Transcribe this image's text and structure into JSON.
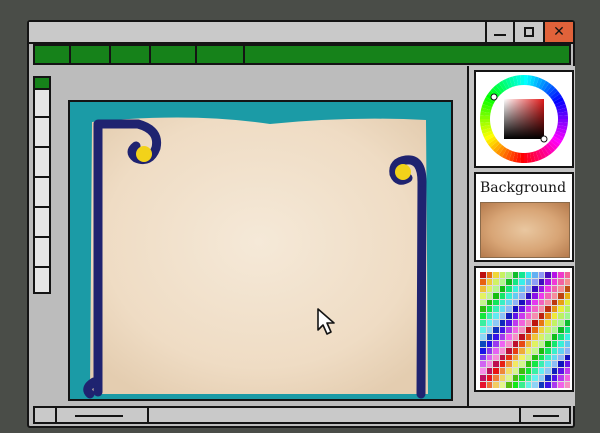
{
  "window": {
    "min_glyph": "",
    "max_glyph": "",
    "close_glyph": "✕",
    "accent_color": "#16821a",
    "close_color": "#e0623a"
  },
  "menubar": {
    "tabs": [
      "",
      "",
      "",
      "",
      ""
    ]
  },
  "toolstrip": {
    "active_color": "#16821a"
  },
  "canvas": {
    "background_color": "#1b9ba6",
    "paper_color": "#f0e1cc",
    "ornament_color": "#1f2370",
    "ornament_accent": "#f2d21a",
    "cursor_icon": "arrow-cursor-icon"
  },
  "color_picker": {
    "wheel_icon": "color-wheel-icon"
  },
  "background_panel": {
    "label": "Background"
  },
  "swatches": {
    "rows": 17,
    "cols": 14
  }
}
